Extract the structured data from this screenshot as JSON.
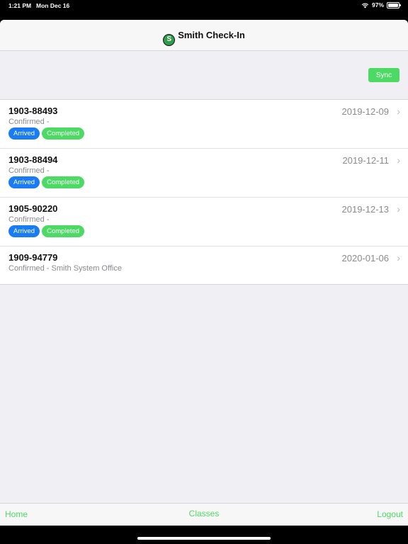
{
  "status_bar": {
    "time": "1:21 PM",
    "date": "Mon Dec 16",
    "battery": "97%",
    "battery_level": 0.97
  },
  "navbar": {
    "title": "Smith Check-In",
    "logo_letter": "S"
  },
  "toolbar": {
    "sync_label": "Sync"
  },
  "rows": [
    {
      "number": "1903-88493",
      "status": "Confirmed -",
      "date": "2019-12-09",
      "badges": [
        "Arrived",
        "Completed"
      ]
    },
    {
      "number": "1903-88494",
      "status": "Confirmed -",
      "date": "2019-12-11",
      "badges": [
        "Arrived",
        "Completed"
      ]
    },
    {
      "number": "1905-90220",
      "status": "Confirmed -",
      "date": "2019-12-13",
      "badges": [
        "Arrived",
        "Completed"
      ]
    },
    {
      "number": "1909-94779",
      "status": "Confirmed - Smith System Office",
      "date": "2020-01-06",
      "badges": []
    }
  ],
  "tabbar": {
    "home": "Home",
    "classes": "Classes",
    "logout": "Logout"
  },
  "colors": {
    "accent_green": "#4cd964",
    "badge_blue": "#1a7cf5",
    "logo_green": "#2e9d4a"
  }
}
